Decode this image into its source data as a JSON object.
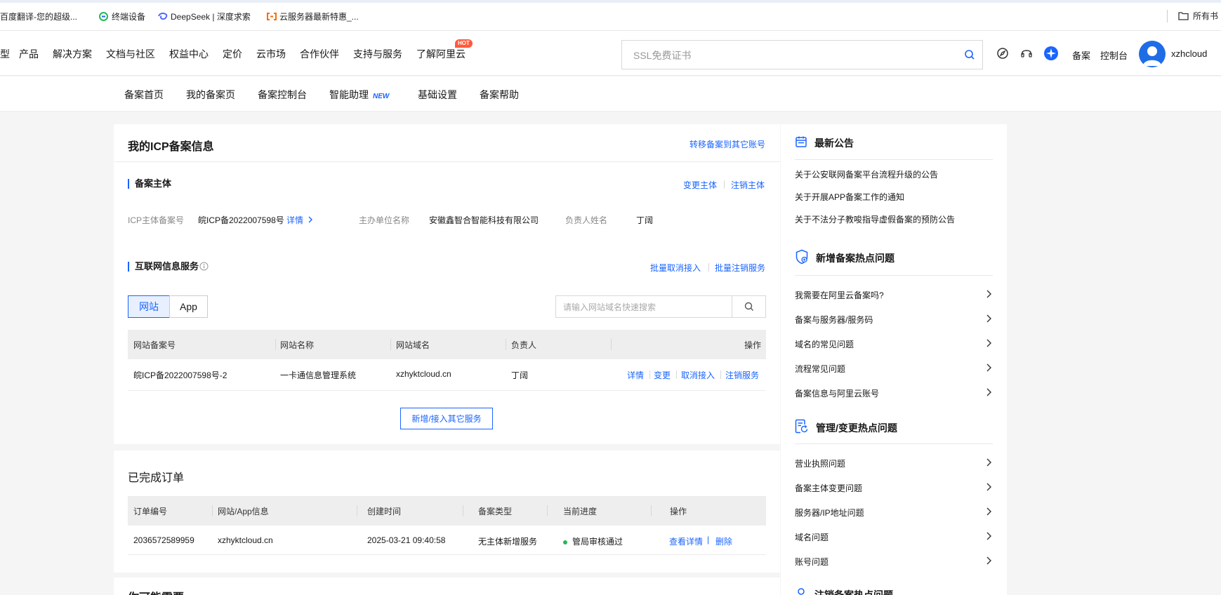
{
  "bookmarks": {
    "items": [
      "百度翻译-您的超级...",
      "终端设备",
      "DeepSeek | 深度求索",
      "云服务器最新特惠_..."
    ],
    "right": "所有书"
  },
  "topnav": {
    "items": [
      "型",
      "产品",
      "解决方案",
      "文档与社区",
      "权益中心",
      "定价",
      "云市场",
      "合作伙伴",
      "支持与服务",
      "了解阿里云"
    ],
    "hot": "HOT",
    "search_placeholder": "SSL免费证书",
    "links": [
      "备案",
      "控制台"
    ],
    "username": "xzhcloud"
  },
  "subnav": {
    "items": [
      "备案首页",
      "我的备案页",
      "备案控制台",
      "智能助理",
      "基础设置",
      "备案帮助"
    ],
    "new_tag": "NEW"
  },
  "main": {
    "title": "我的ICP备案信息",
    "transfer_link": "转移备案到其它账号",
    "subject": {
      "title": "备案主体",
      "change": "变更主体",
      "cancel": "注销主体",
      "icp_label": "ICP主体备案号",
      "icp_value": "皖ICP备2022007598号",
      "details": "详情",
      "org_label": "主办单位名称",
      "org_value": "安徽鑫智合智能科技有限公司",
      "person_label": "负责人姓名",
      "person_value": "丁阔"
    },
    "service": {
      "title": "互联网信息服务",
      "batch_disconnect": "批量取消接入",
      "batch_cancel": "批量注销服务",
      "tabs": [
        "网站",
        "App"
      ],
      "search_placeholder": "请输入网站域名快速搜索",
      "columns": [
        "网站备案号",
        "网站名称",
        "网站域名",
        "负责人",
        "操作"
      ],
      "rows": [
        {
          "icp": "皖ICP备2022007598号-2",
          "name": "一卡通信息管理系统",
          "domain": "xzhyktcloud.cn",
          "owner": "丁阔"
        }
      ],
      "actions": [
        "详情",
        "变更",
        "取消接入",
        "注销服务"
      ],
      "add_button": "新增/接入其它服务"
    }
  },
  "orders": {
    "title": "已完成订单",
    "columns": [
      "订单编号",
      "网站/App信息",
      "创建时间",
      "备案类型",
      "当前进度",
      "操作"
    ],
    "rows": [
      {
        "id": "2036572589959",
        "info": "xzhyktcloud.cn",
        "time": "2025-03-21 09:40:58",
        "type": "无主体新增服务",
        "status": "管局审核通过"
      }
    ],
    "actions": [
      "查看详情",
      "删除"
    ],
    "status_color": "#26b856"
  },
  "extra": {
    "title": "你可能需要"
  },
  "side": {
    "notice_title": "最新公告",
    "notices": [
      "关于公安联网备案平台流程升级的公告",
      "关于开展APP备案工作的通知",
      "关于不法分子教唆指导虚假备案的预防公告"
    ],
    "hot_title": "新增备案热点问题",
    "hot_items": [
      "我需要在阿里云备案吗?",
      "备案与服务器/服务码",
      "域名的常见问题",
      "流程常见问题",
      "备案信息与阿里云账号"
    ],
    "manage_title": "管理/变更热点问题",
    "manage_items": [
      "营业执照问题",
      "备案主体变更问题",
      "服务器/IP地址问题",
      "域名问题",
      "账号问题"
    ],
    "cancel_title": "注销备案热点问题"
  },
  "colors": {
    "accent": "#1a64ff",
    "hot": "#ff5a3c"
  }
}
